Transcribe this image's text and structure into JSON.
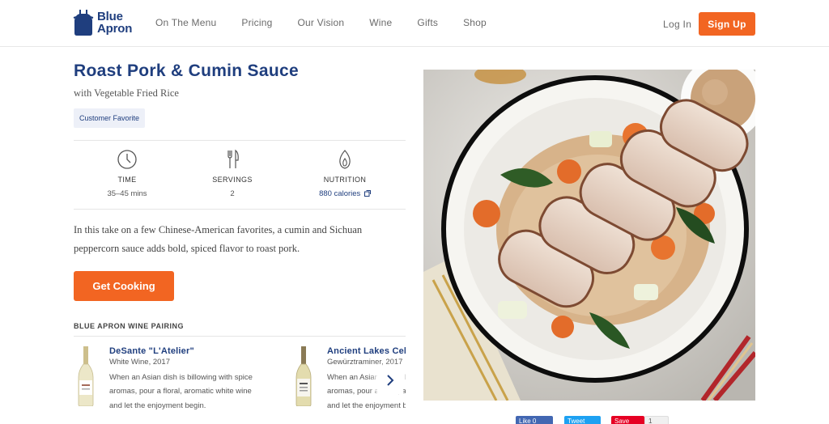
{
  "brand": {
    "line1": "Blue",
    "line2": "Apron",
    "color": "#1f3e7e",
    "accent": "#f26522"
  },
  "nav": [
    "On The Menu",
    "Pricing",
    "Our Vision",
    "Wine",
    "Gifts",
    "Shop"
  ],
  "auth": {
    "login": "Log In",
    "signup": "Sign Up"
  },
  "recipe": {
    "title": "Roast Pork & Cumin Sauce",
    "subtitle": "with Vegetable Fried Rice",
    "badge": "Customer Favorite",
    "stats": [
      {
        "icon": "clock-icon",
        "label": "TIME",
        "value": "35–45 mins"
      },
      {
        "icon": "fork-knife-icon",
        "label": "SERVINGS",
        "value": "2"
      },
      {
        "icon": "flame-icon",
        "label": "NUTRITION",
        "value": "880 calories"
      }
    ],
    "description": "In this take on a few Chinese-American favorites, a cumin and Sichuan peppercorn sauce adds bold, spiced flavor to roast pork.",
    "cta": "Get Cooking"
  },
  "pairing": {
    "heading": "BLUE APRON WINE PAIRING",
    "wines": [
      {
        "name": "DeSante \"L'Atelier\"",
        "type": "White Wine, 2017",
        "text": "When an Asian dish is billowing with spice aromas, pour a floral, aromatic white wine and let the enjoyment begin."
      },
      {
        "name": "Ancient Lakes Cellars",
        "type": "Gewürztraminer, 2017",
        "text": "When an Asian dish is billowing with spice aromas, pour a floral, aromatic white wine and let the enjoyment begin."
      }
    ]
  },
  "social": {
    "like": "Like 0",
    "tweet": "Tweet",
    "save": "Save",
    "count": "1"
  }
}
